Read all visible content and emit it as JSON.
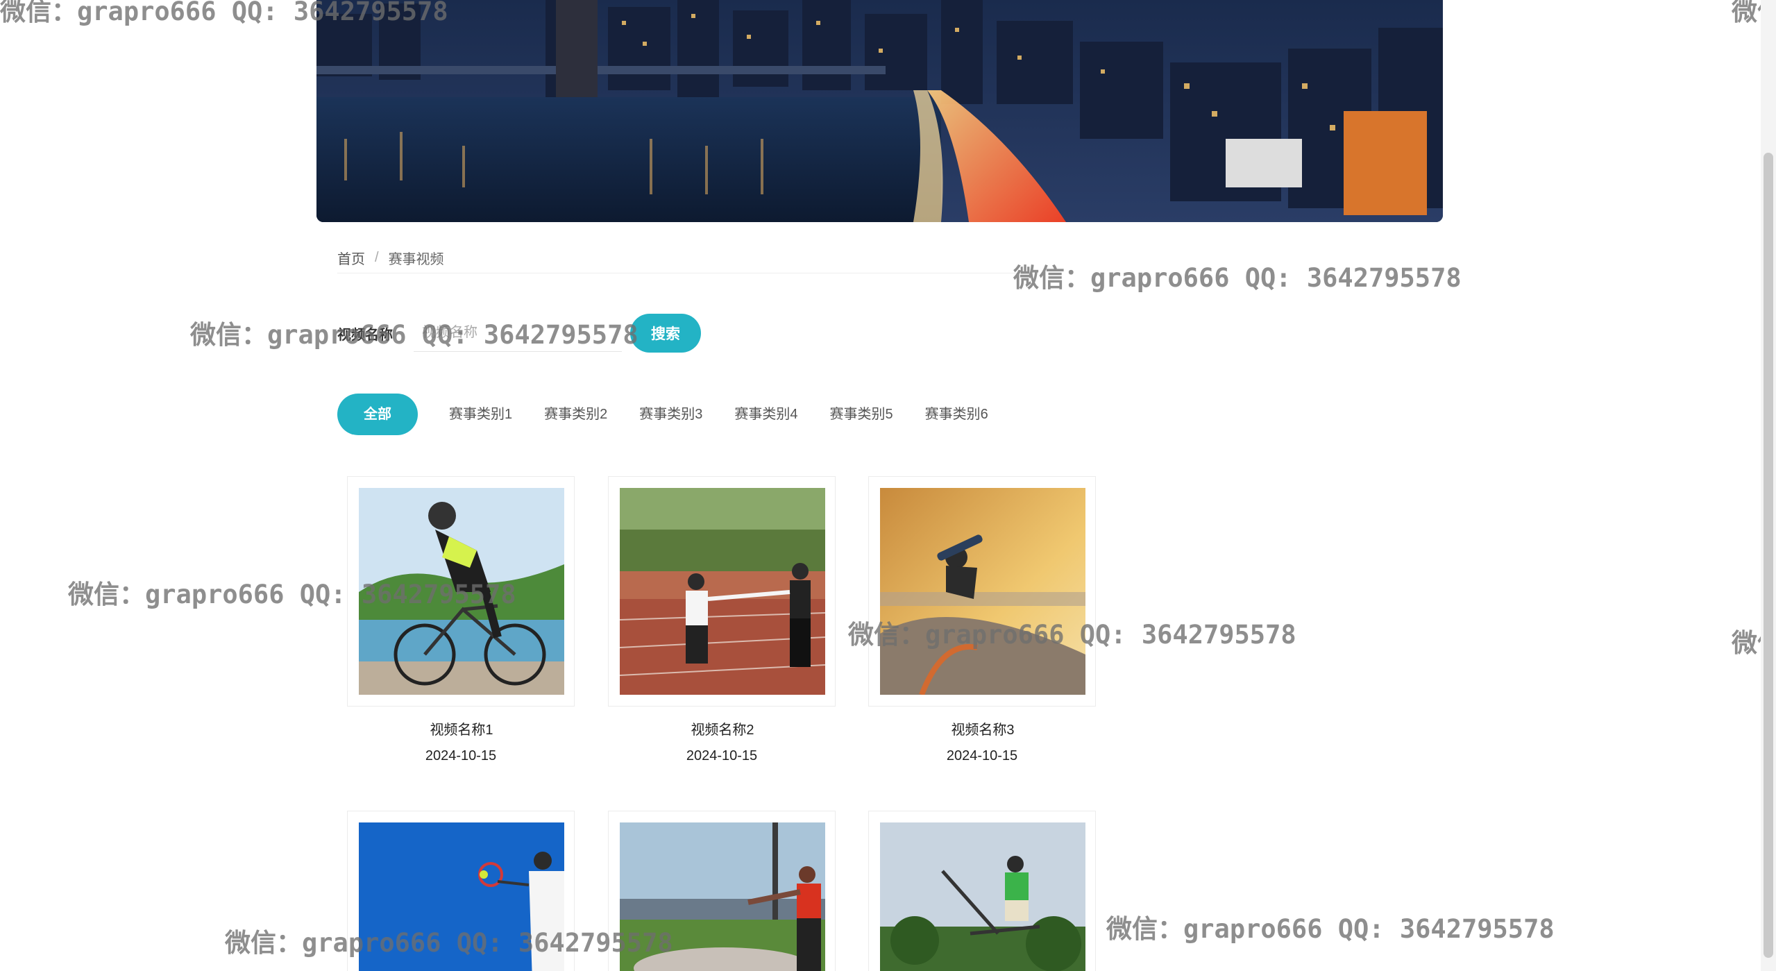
{
  "breadcrumb": {
    "home": "首页",
    "separator": "/",
    "current": "赛事视频"
  },
  "search": {
    "label": "视频名称",
    "placeholder": "视频名称",
    "button": "搜索"
  },
  "tabs": [
    {
      "label": "全部",
      "active": true
    },
    {
      "label": "赛事类别1"
    },
    {
      "label": "赛事类别2"
    },
    {
      "label": "赛事类别3"
    },
    {
      "label": "赛事类别4"
    },
    {
      "label": "赛事类别5"
    },
    {
      "label": "赛事类别6"
    }
  ],
  "videos": [
    {
      "title": "视频名称1",
      "date": "2024-10-15",
      "image": "cyclist"
    },
    {
      "title": "视频名称2",
      "date": "2024-10-15",
      "image": "relay-runners"
    },
    {
      "title": "视频名称3",
      "date": "2024-10-15",
      "image": "skateboarder"
    },
    {
      "title": "",
      "date": "",
      "image": "tennis-player"
    },
    {
      "title": "",
      "date": "",
      "image": "discus-thrower"
    },
    {
      "title": "",
      "date": "",
      "image": "scooter-rider"
    }
  ],
  "watermark": "微信：grapro666 QQ: 3642795578",
  "colors": {
    "accent": "#23b3c5"
  }
}
